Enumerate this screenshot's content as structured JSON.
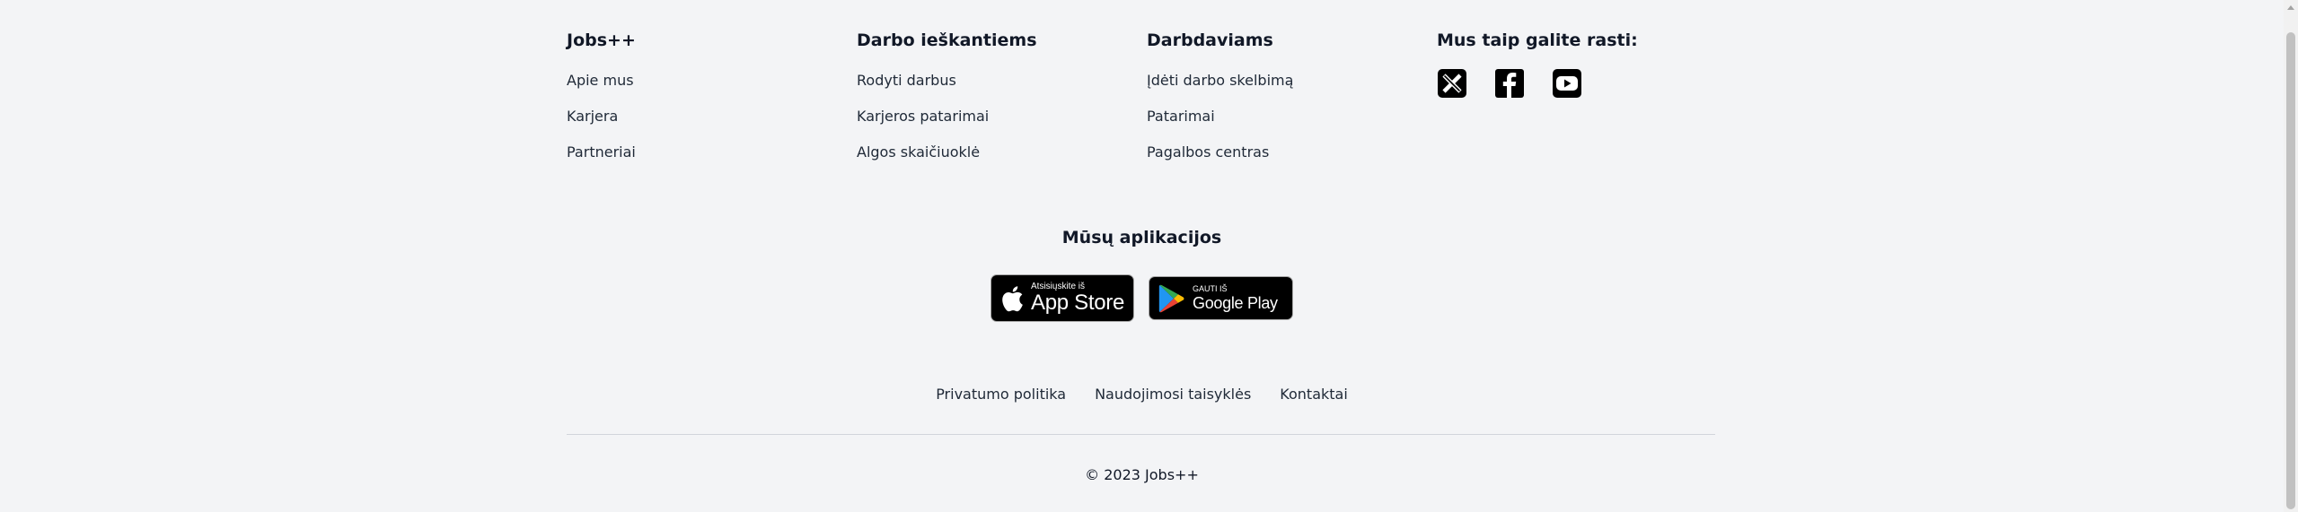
{
  "columns": [
    {
      "title": "Jobs++",
      "links": [
        "Apie mus",
        "Karjera",
        "Partneriai"
      ]
    },
    {
      "title": "Darbo ieškantiems",
      "links": [
        "Rodyti darbus",
        "Karjeros patarimai",
        "Algos skaičiuoklė"
      ]
    },
    {
      "title": "Darbdaviams",
      "links": [
        "Įdėti darbo skelbimą",
        "Patarimai",
        "Pagalbos centras"
      ]
    },
    {
      "title": "Mus taip galite rasti:",
      "socials": [
        "x-icon",
        "facebook-icon",
        "youtube-icon"
      ]
    }
  ],
  "apps": {
    "title": "Mūsų aplikacijos",
    "apple_small": "Atsisiųskite iš",
    "apple_big": "App Store",
    "google_small": "GAUTI IŠ",
    "google_big": "Google Play"
  },
  "bottom_links": [
    "Privatumo politika",
    "Naudojimosi taisyklės",
    "Kontaktai"
  ],
  "copyright": "© 2023 Jobs++"
}
